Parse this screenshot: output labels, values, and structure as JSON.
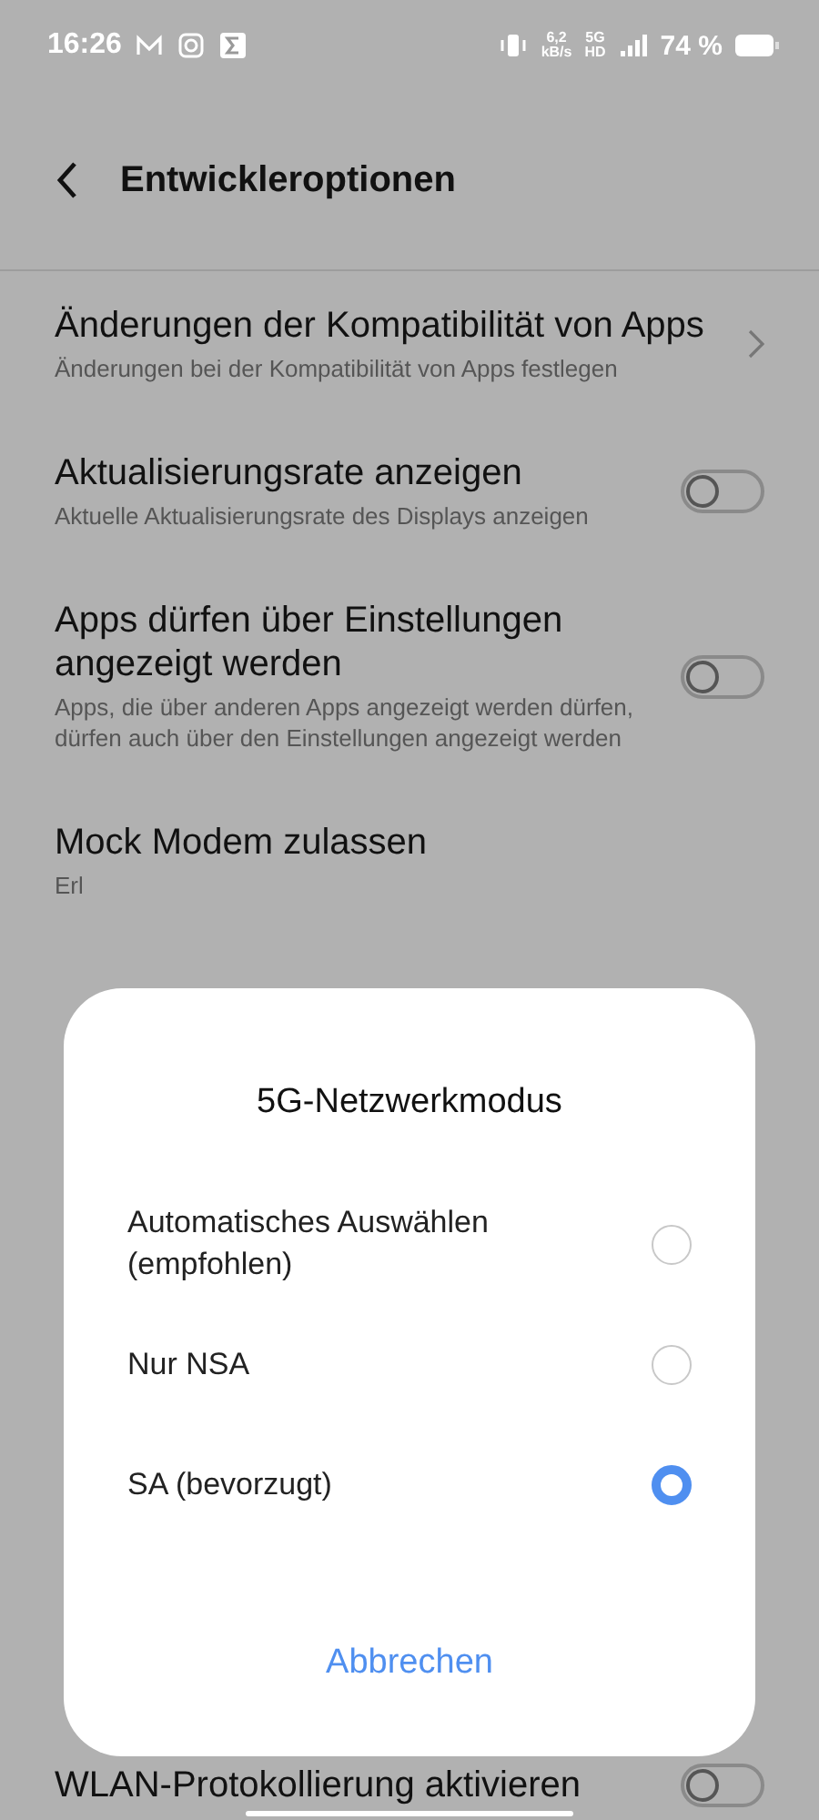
{
  "status_bar": {
    "time": "16:26",
    "speed_value": "6,2",
    "speed_unit": "kB/s",
    "network": "5G",
    "network_quality": "HD",
    "battery": "74 %"
  },
  "header": {
    "title": "Entwickleroptionen"
  },
  "items": [
    {
      "kind": "chevron",
      "title": "Änderungen der Kompatibilität von Apps",
      "subtitle": "Änderungen bei der Kompatibilität von Apps festlegen"
    },
    {
      "kind": "toggle",
      "on": false,
      "title": "Aktualisierungsrate anzeigen",
      "subtitle": "Aktuelle Aktualisierungsrate des Displays anzeigen"
    },
    {
      "kind": "toggle",
      "on": false,
      "title": "Apps dürfen über Einstellungen angezeigt werden",
      "subtitle": "Apps, die über anderen Apps angezeigt werden dürfen, dürfen auch über den Einstellungen angezeigt werden"
    },
    {
      "kind": "plain",
      "title": "Mock Modem zulassen",
      "subtitle": "Erl"
    },
    {
      "kind": "toggle",
      "on": false,
      "title": "WLAN-Protokollierung aktivieren"
    }
  ],
  "dialog": {
    "title": "5G-Netzwerkmodus",
    "options": [
      {
        "label": "Automatisches Auswählen (empfohlen)",
        "selected": false
      },
      {
        "label": "Nur NSA",
        "selected": false
      },
      {
        "label": "SA (bevorzugt)",
        "selected": true
      }
    ],
    "cancel": "Abbrechen"
  }
}
